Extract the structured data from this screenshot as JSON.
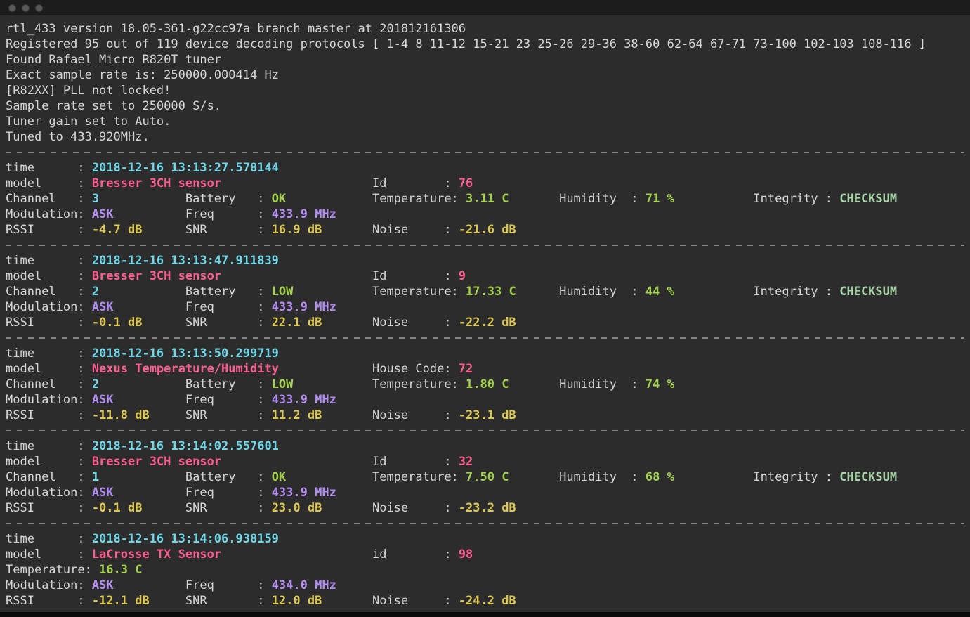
{
  "window": {
    "buttons": [
      {
        "name": "close"
      },
      {
        "name": "minimize"
      },
      {
        "name": "zoom"
      }
    ]
  },
  "palette": {
    "background": "#2c2c2c",
    "foreground": "#d4d4d4",
    "titlebar": "#1c1c1c",
    "window_button": "#585858",
    "separator": "#858585",
    "cyan": "#6fd7e8",
    "pink": "#ff5f8f",
    "green": "#a5d24d",
    "yellow": "#ddc94f",
    "purple": "#b38df2",
    "pale": "#a9d5a9"
  },
  "terminal": {
    "header_lines": [
      "rtl_433 version 18.05-361-g22cc97a branch master at 201812161306",
      "Registered 95 out of 119 device decoding protocols [ 1-4 8 11-12 15-21 23 25-26 29-36 38-60 62-64 67-71 73-100 102-103 108-116 ]",
      "Found Rafael Micro R820T tuner",
      "Exact sample rate is: 250000.000414 Hz",
      "[R82XX] PLL not locked!",
      "Sample rate set to 250000 S/s.",
      "Tuner gain set to Auto.",
      "Tuned to 433.920MHz."
    ],
    "blocks": [
      {
        "lines": [
          [
            {
              "col": 0,
              "color": "fg",
              "text": "time      :"
            },
            {
              "col": 12,
              "color": "cyan",
              "text": "2018-12-16 13:13:27.578144"
            }
          ],
          [
            {
              "col": 0,
              "color": "fg",
              "text": "model     :"
            },
            {
              "col": 12,
              "color": "pink",
              "text": "Bresser 3CH sensor"
            },
            {
              "col": 51,
              "color": "fg",
              "text": "Id        :"
            },
            {
              "col": 63,
              "color": "pink",
              "text": "76"
            }
          ],
          [
            {
              "col": 0,
              "color": "fg",
              "text": "Channel   :"
            },
            {
              "col": 12,
              "color": "cyan",
              "text": "3"
            },
            {
              "col": 25,
              "color": "fg",
              "text": "Battery   :"
            },
            {
              "col": 37,
              "color": "green",
              "text": "OK"
            },
            {
              "col": 51,
              "color": "fg",
              "text": "Temperature:"
            },
            {
              "col": 64,
              "color": "green",
              "text": "3.11 C"
            },
            {
              "col": 77,
              "color": "fg",
              "text": "Humidity  :"
            },
            {
              "col": 89,
              "color": "green",
              "text": "71 %"
            },
            {
              "col": 104,
              "color": "fg",
              "text": "Integrity :"
            },
            {
              "col": 116,
              "color": "pale",
              "text": "CHECKSUM"
            }
          ],
          [
            {
              "col": 0,
              "color": "fg",
              "text": "Modulation:"
            },
            {
              "col": 12,
              "color": "purple",
              "text": "ASK"
            },
            {
              "col": 25,
              "color": "fg",
              "text": "Freq      :"
            },
            {
              "col": 37,
              "color": "purple",
              "text": "433.9 MHz"
            }
          ],
          [
            {
              "col": 0,
              "color": "fg",
              "text": "RSSI      :"
            },
            {
              "col": 12,
              "color": "yellow",
              "text": "-4.7 dB"
            },
            {
              "col": 25,
              "color": "fg",
              "text": "SNR       :"
            },
            {
              "col": 37,
              "color": "yellow",
              "text": "16.9 dB"
            },
            {
              "col": 51,
              "color": "fg",
              "text": "Noise     :"
            },
            {
              "col": 63,
              "color": "yellow",
              "text": "-21.6 dB"
            }
          ]
        ]
      },
      {
        "lines": [
          [
            {
              "col": 0,
              "color": "fg",
              "text": "time      :"
            },
            {
              "col": 12,
              "color": "cyan",
              "text": "2018-12-16 13:13:47.911839"
            }
          ],
          [
            {
              "col": 0,
              "color": "fg",
              "text": "model     :"
            },
            {
              "col": 12,
              "color": "pink",
              "text": "Bresser 3CH sensor"
            },
            {
              "col": 51,
              "color": "fg",
              "text": "Id        :"
            },
            {
              "col": 63,
              "color": "pink",
              "text": "9"
            }
          ],
          [
            {
              "col": 0,
              "color": "fg",
              "text": "Channel   :"
            },
            {
              "col": 12,
              "color": "cyan",
              "text": "2"
            },
            {
              "col": 25,
              "color": "fg",
              "text": "Battery   :"
            },
            {
              "col": 37,
              "color": "green",
              "text": "LOW"
            },
            {
              "col": 51,
              "color": "fg",
              "text": "Temperature:"
            },
            {
              "col": 64,
              "color": "green",
              "text": "17.33 C"
            },
            {
              "col": 77,
              "color": "fg",
              "text": "Humidity  :"
            },
            {
              "col": 89,
              "color": "green",
              "text": "44 %"
            },
            {
              "col": 104,
              "color": "fg",
              "text": "Integrity :"
            },
            {
              "col": 116,
              "color": "pale",
              "text": "CHECKSUM"
            }
          ],
          [
            {
              "col": 0,
              "color": "fg",
              "text": "Modulation:"
            },
            {
              "col": 12,
              "color": "purple",
              "text": "ASK"
            },
            {
              "col": 25,
              "color": "fg",
              "text": "Freq      :"
            },
            {
              "col": 37,
              "color": "purple",
              "text": "433.9 MHz"
            }
          ],
          [
            {
              "col": 0,
              "color": "fg",
              "text": "RSSI      :"
            },
            {
              "col": 12,
              "color": "yellow",
              "text": "-0.1 dB"
            },
            {
              "col": 25,
              "color": "fg",
              "text": "SNR       :"
            },
            {
              "col": 37,
              "color": "yellow",
              "text": "22.1 dB"
            },
            {
              "col": 51,
              "color": "fg",
              "text": "Noise     :"
            },
            {
              "col": 63,
              "color": "yellow",
              "text": "-22.2 dB"
            }
          ]
        ]
      },
      {
        "lines": [
          [
            {
              "col": 0,
              "color": "fg",
              "text": "time      :"
            },
            {
              "col": 12,
              "color": "cyan",
              "text": "2018-12-16 13:13:50.299719"
            }
          ],
          [
            {
              "col": 0,
              "color": "fg",
              "text": "model     :"
            },
            {
              "col": 12,
              "color": "pink",
              "text": "Nexus Temperature/Humidity"
            },
            {
              "col": 51,
              "color": "fg",
              "text": "House Code:"
            },
            {
              "col": 63,
              "color": "pink",
              "text": "72"
            }
          ],
          [
            {
              "col": 0,
              "color": "fg",
              "text": "Channel   :"
            },
            {
              "col": 12,
              "color": "cyan",
              "text": "2"
            },
            {
              "col": 25,
              "color": "fg",
              "text": "Battery   :"
            },
            {
              "col": 37,
              "color": "green",
              "text": "LOW"
            },
            {
              "col": 51,
              "color": "fg",
              "text": "Temperature:"
            },
            {
              "col": 64,
              "color": "green",
              "text": "1.80 C"
            },
            {
              "col": 77,
              "color": "fg",
              "text": "Humidity  :"
            },
            {
              "col": 89,
              "color": "green",
              "text": "74 %"
            }
          ],
          [
            {
              "col": 0,
              "color": "fg",
              "text": "Modulation:"
            },
            {
              "col": 12,
              "color": "purple",
              "text": "ASK"
            },
            {
              "col": 25,
              "color": "fg",
              "text": "Freq      :"
            },
            {
              "col": 37,
              "color": "purple",
              "text": "433.9 MHz"
            }
          ],
          [
            {
              "col": 0,
              "color": "fg",
              "text": "RSSI      :"
            },
            {
              "col": 12,
              "color": "yellow",
              "text": "-11.8 dB"
            },
            {
              "col": 25,
              "color": "fg",
              "text": "SNR       :"
            },
            {
              "col": 37,
              "color": "yellow",
              "text": "11.2 dB"
            },
            {
              "col": 51,
              "color": "fg",
              "text": "Noise     :"
            },
            {
              "col": 63,
              "color": "yellow",
              "text": "-23.1 dB"
            }
          ]
        ]
      },
      {
        "lines": [
          [
            {
              "col": 0,
              "color": "fg",
              "text": "time      :"
            },
            {
              "col": 12,
              "color": "cyan",
              "text": "2018-12-16 13:14:02.557601"
            }
          ],
          [
            {
              "col": 0,
              "color": "fg",
              "text": "model     :"
            },
            {
              "col": 12,
              "color": "pink",
              "text": "Bresser 3CH sensor"
            },
            {
              "col": 51,
              "color": "fg",
              "text": "Id        :"
            },
            {
              "col": 63,
              "color": "pink",
              "text": "32"
            }
          ],
          [
            {
              "col": 0,
              "color": "fg",
              "text": "Channel   :"
            },
            {
              "col": 12,
              "color": "cyan",
              "text": "1"
            },
            {
              "col": 25,
              "color": "fg",
              "text": "Battery   :"
            },
            {
              "col": 37,
              "color": "green",
              "text": "OK"
            },
            {
              "col": 51,
              "color": "fg",
              "text": "Temperature:"
            },
            {
              "col": 64,
              "color": "green",
              "text": "7.50 C"
            },
            {
              "col": 77,
              "color": "fg",
              "text": "Humidity  :"
            },
            {
              "col": 89,
              "color": "green",
              "text": "68 %"
            },
            {
              "col": 104,
              "color": "fg",
              "text": "Integrity :"
            },
            {
              "col": 116,
              "color": "pale",
              "text": "CHECKSUM"
            }
          ],
          [
            {
              "col": 0,
              "color": "fg",
              "text": "Modulation:"
            },
            {
              "col": 12,
              "color": "purple",
              "text": "ASK"
            },
            {
              "col": 25,
              "color": "fg",
              "text": "Freq      :"
            },
            {
              "col": 37,
              "color": "purple",
              "text": "433.9 MHz"
            }
          ],
          [
            {
              "col": 0,
              "color": "fg",
              "text": "RSSI      :"
            },
            {
              "col": 12,
              "color": "yellow",
              "text": "-0.1 dB"
            },
            {
              "col": 25,
              "color": "fg",
              "text": "SNR       :"
            },
            {
              "col": 37,
              "color": "yellow",
              "text": "23.0 dB"
            },
            {
              "col": 51,
              "color": "fg",
              "text": "Noise     :"
            },
            {
              "col": 63,
              "color": "yellow",
              "text": "-23.2 dB"
            }
          ]
        ]
      },
      {
        "lines": [
          [
            {
              "col": 0,
              "color": "fg",
              "text": "time      :"
            },
            {
              "col": 12,
              "color": "cyan",
              "text": "2018-12-16 13:14:06.938159"
            }
          ],
          [
            {
              "col": 0,
              "color": "fg",
              "text": "model     :"
            },
            {
              "col": 12,
              "color": "pink",
              "text": "LaCrosse TX Sensor"
            },
            {
              "col": 51,
              "color": "fg",
              "text": "id        :"
            },
            {
              "col": 63,
              "color": "pink",
              "text": "98"
            }
          ],
          [
            {
              "col": 0,
              "color": "fg",
              "text": "Temperature:"
            },
            {
              "col": 13,
              "color": "green",
              "text": "16.3 C"
            }
          ],
          [
            {
              "col": 0,
              "color": "fg",
              "text": "Modulation:"
            },
            {
              "col": 12,
              "color": "purple",
              "text": "ASK"
            },
            {
              "col": 25,
              "color": "fg",
              "text": "Freq      :"
            },
            {
              "col": 37,
              "color": "purple",
              "text": "434.0 MHz"
            }
          ],
          [
            {
              "col": 0,
              "color": "fg",
              "text": "RSSI      :"
            },
            {
              "col": 12,
              "color": "yellow",
              "text": "-12.1 dB"
            },
            {
              "col": 25,
              "color": "fg",
              "text": "SNR       :"
            },
            {
              "col": 37,
              "color": "yellow",
              "text": "12.0 dB"
            },
            {
              "col": 51,
              "color": "fg",
              "text": "Noise     :"
            },
            {
              "col": 63,
              "color": "yellow",
              "text": "-24.2 dB"
            }
          ]
        ]
      }
    ]
  }
}
